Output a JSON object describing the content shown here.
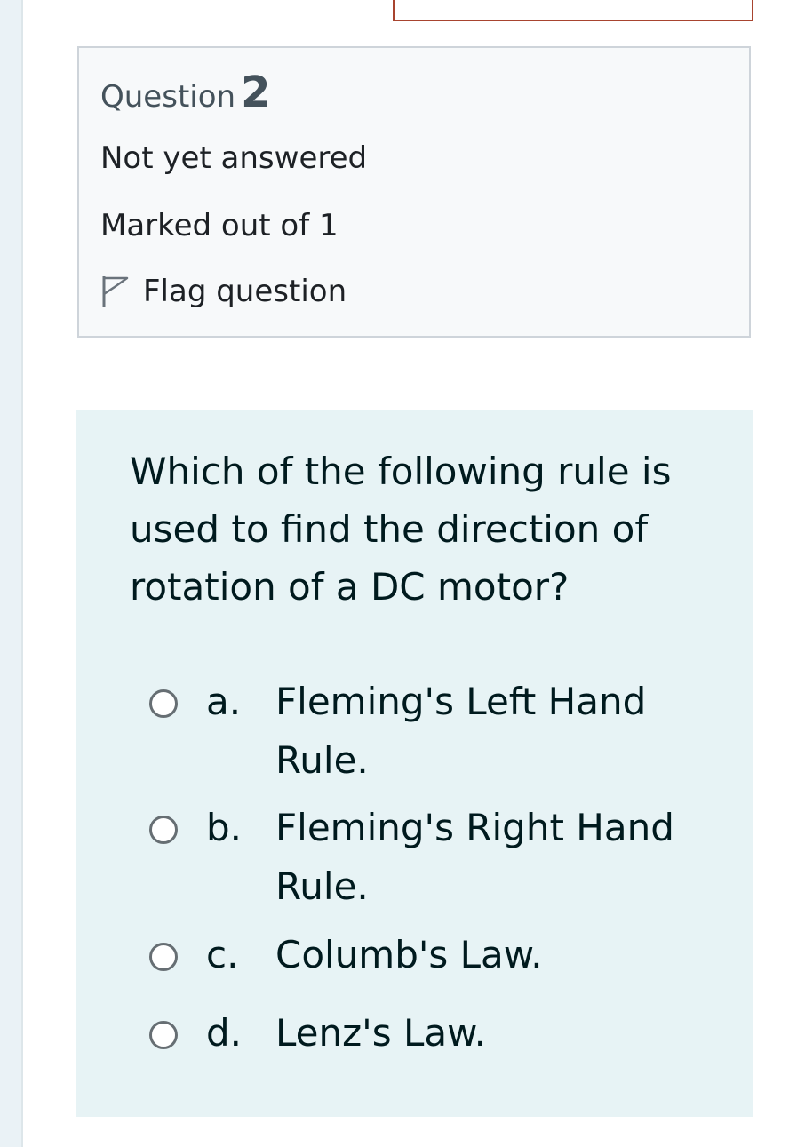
{
  "question_info": {
    "label": "Question",
    "number": "2",
    "state": "Not yet answered",
    "grade": "Marked out of 1",
    "flag_label": "Flag question"
  },
  "question": {
    "text": "Which of the following rule is used to find the direction of rotation of a DC motor?",
    "answers": [
      {
        "letter": "a.",
        "text": "Fleming's Left Hand Rule.",
        "selected": false
      },
      {
        "letter": "b.",
        "text": "Fleming's Right Hand Rule.",
        "selected": false
      },
      {
        "letter": "c.",
        "text": "Columb's Law.",
        "selected": false
      },
      {
        "letter": "d.",
        "text": "Lenz's Law.",
        "selected": false
      }
    ]
  },
  "icons": {
    "flag": "flag-outline-icon",
    "radio": "radio-unchecked-icon"
  },
  "colors": {
    "info_background": "#f7f9fa",
    "question_background": "#e7f3f5",
    "text": "#1d2125",
    "previous_box_border": "#a8442f"
  }
}
